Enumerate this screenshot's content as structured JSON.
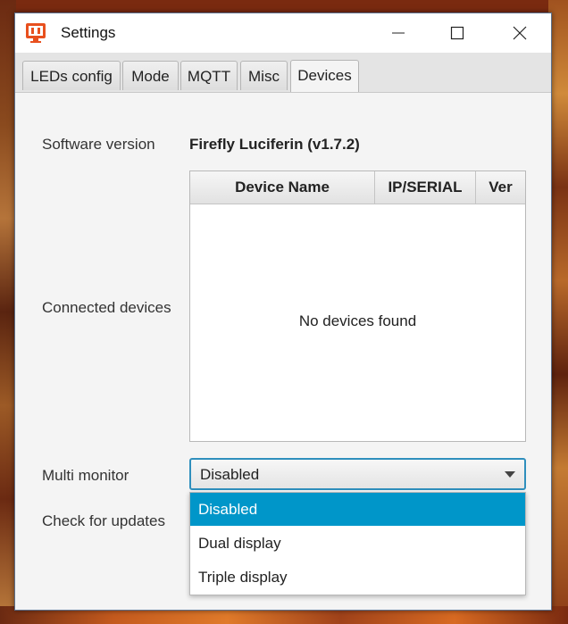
{
  "window": {
    "title": "Settings",
    "icon": "firefly-luciferin-icon"
  },
  "tabs": [
    {
      "label": "LEDs config",
      "active": false
    },
    {
      "label": "Mode",
      "active": false
    },
    {
      "label": "MQTT",
      "active": false
    },
    {
      "label": "Misc",
      "active": false
    },
    {
      "label": "Devices",
      "active": true
    }
  ],
  "devices_panel": {
    "software_version_label": "Software version",
    "software_version_value": "Firefly Luciferin (v1.7.2)",
    "connected_devices_label": "Connected devices",
    "table": {
      "columns": [
        "Device Name",
        "IP/SERIAL",
        "Ver"
      ],
      "rows": [],
      "empty_message": "No devices found"
    },
    "multi_monitor_label": "Multi monitor",
    "multi_monitor_value": "Disabled",
    "multi_monitor_options": [
      "Disabled",
      "Dual display",
      "Triple display"
    ],
    "check_updates_label": "Check for updates"
  },
  "colors": {
    "accent": "#0096c9",
    "focus_border": "#2f8fbd",
    "app_icon": "#e8501e"
  }
}
